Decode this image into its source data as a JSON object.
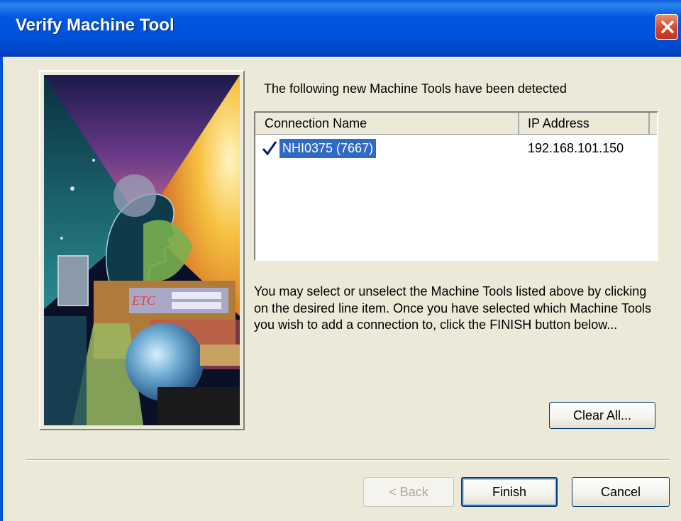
{
  "window": {
    "title": "Verify Machine Tool",
    "icons": {
      "close": "close-icon"
    }
  },
  "artwork": {
    "caption": "ETC"
  },
  "main": {
    "detected_label": "The following new Machine Tools have been detected",
    "list": {
      "columns": [
        "Connection Name",
        "IP Address"
      ],
      "rows": [
        {
          "checked": true,
          "name": "NHI0375 (7667)",
          "ip": "192.168.101.150",
          "selected": true
        }
      ]
    },
    "instructions": "You may select or unselect the Machine Tools listed above by clicking on the desired line item.  Once you have selected which Machine Tools you wish to add a connection to, click the FINISH button below...",
    "clear_all_label": "Clear All..."
  },
  "footer": {
    "back_label": "< Back",
    "finish_label": "Finish",
    "cancel_label": "Cancel"
  },
  "colors": {
    "titlebar": "#0054E3",
    "selection": "#316AC5",
    "dialog_bg": "#ECE9D8",
    "close_button": "#D6452A"
  }
}
